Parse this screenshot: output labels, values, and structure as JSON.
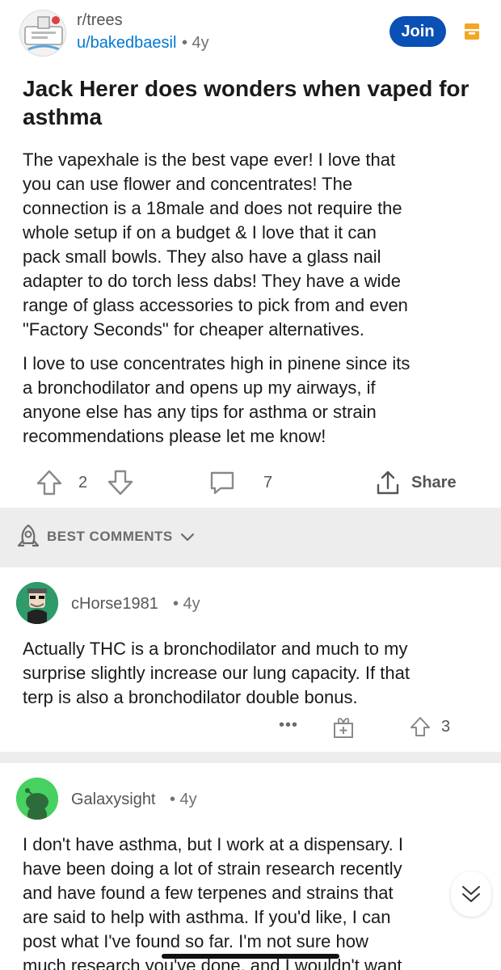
{
  "post": {
    "subreddit": "r/trees",
    "author": "u/bakedbaesil",
    "age": "• 4y",
    "join_label": "Join",
    "title": "Jack Herer does wonders when vaped for asthma",
    "paragraphs": [
      "The vapexhale is the best vape ever! I love that\nyou can use flower and concentrates! The\nconnection is a 18male and does not require the\nwhole setup if on a budget & I love that it can\npack small bowls. They also have a glass nail\nadapter to do torch less dabs! They have a wide\nrange of glass accessories to pick from and even\n\"Factory Seconds\" for cheaper alternatives.",
      "I love to use concentrates high in pinene since its\na bronchodilator and opens up my airways, if\nanyone else has any tips for asthma or strain\nrecommendations please let me know!"
    ],
    "votes": "2",
    "comment_count": "7",
    "share_label": "Share"
  },
  "sort": {
    "label": "BEST COMMENTS"
  },
  "comments": [
    {
      "author": "cHorse1981",
      "age": "• 4y",
      "body": "Actually THC is a bronchodilator and much to my\nsurprise slightly increase our lung capacity. If that\nterp is also a bronchodilator double bonus.",
      "more_label": "•••",
      "votes": "3"
    },
    {
      "author": "Galaxysight",
      "age": "• 4y",
      "body": "I don't have asthma, but I work at a dispensary. I\nhave been doing a lot of strain research recently\nand have found a few terpenes and strains that\nare said to help with asthma. If you'd like, I can\npost what I've found so far. I'm not sure how\nmuch research you've done, and I wouldn't want"
    }
  ],
  "colors": {
    "accent": "#0a50b5",
    "link": "#0079d3",
    "award": "#f5a623",
    "divider": "#ededed",
    "avatar_green": "#46d160"
  },
  "icons": [
    "subreddit-icon",
    "award-icon",
    "upvote-icon",
    "downvote-icon",
    "comment-icon",
    "share-icon",
    "rocket-icon",
    "chevron-down-icon",
    "more-icon",
    "gift-icon",
    "scroll-down-icon"
  ]
}
